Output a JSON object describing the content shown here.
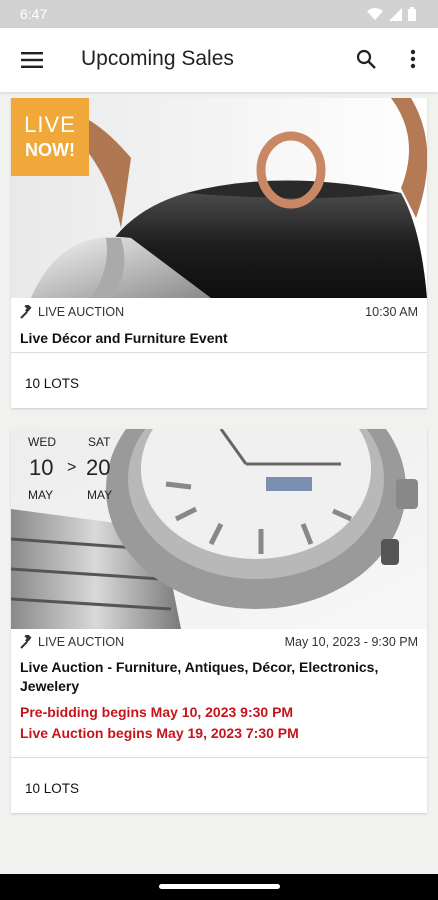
{
  "status_bar": {
    "time": "6:47"
  },
  "app_bar": {
    "title": "Upcoming Sales"
  },
  "sales": [
    {
      "badge": {
        "line1": "LIVE",
        "line2": "NOW!"
      },
      "auction_type": "LIVE AUCTION",
      "time": "10:30 AM",
      "title": "Live Décor and Furniture Event",
      "lots": "10 LOTS"
    },
    {
      "dates": {
        "start_dow": "WED",
        "start_day": "10",
        "start_month": "MAY",
        "arrow": ">",
        "end_dow": "SAT",
        "end_day": "20",
        "end_month": "MAY"
      },
      "auction_type": "LIVE AUCTION",
      "time": "May 10, 2023 - 9:30 PM",
      "title": "Live Auction - Furniture, Antiques, Décor, Electronics, Jewelery",
      "prebid_line": "Pre-bidding begins May 10, 2023  9:30 PM",
      "live_line": "Live Auction begins May 19, 2023  7:30 PM",
      "lots": "10 LOTS"
    }
  ],
  "colors": {
    "badge": "#f0a83a",
    "alert": "#c5141b",
    "app_bar": "#ffffff",
    "background": "#f1f1ef"
  },
  "icons": {
    "menu": "hamburger-menu-icon",
    "search": "search-icon",
    "more": "more-vertical-icon",
    "gavel": "gavel-icon",
    "wifi": "wifi-icon",
    "signal": "signal-icon",
    "battery": "battery-icon"
  }
}
